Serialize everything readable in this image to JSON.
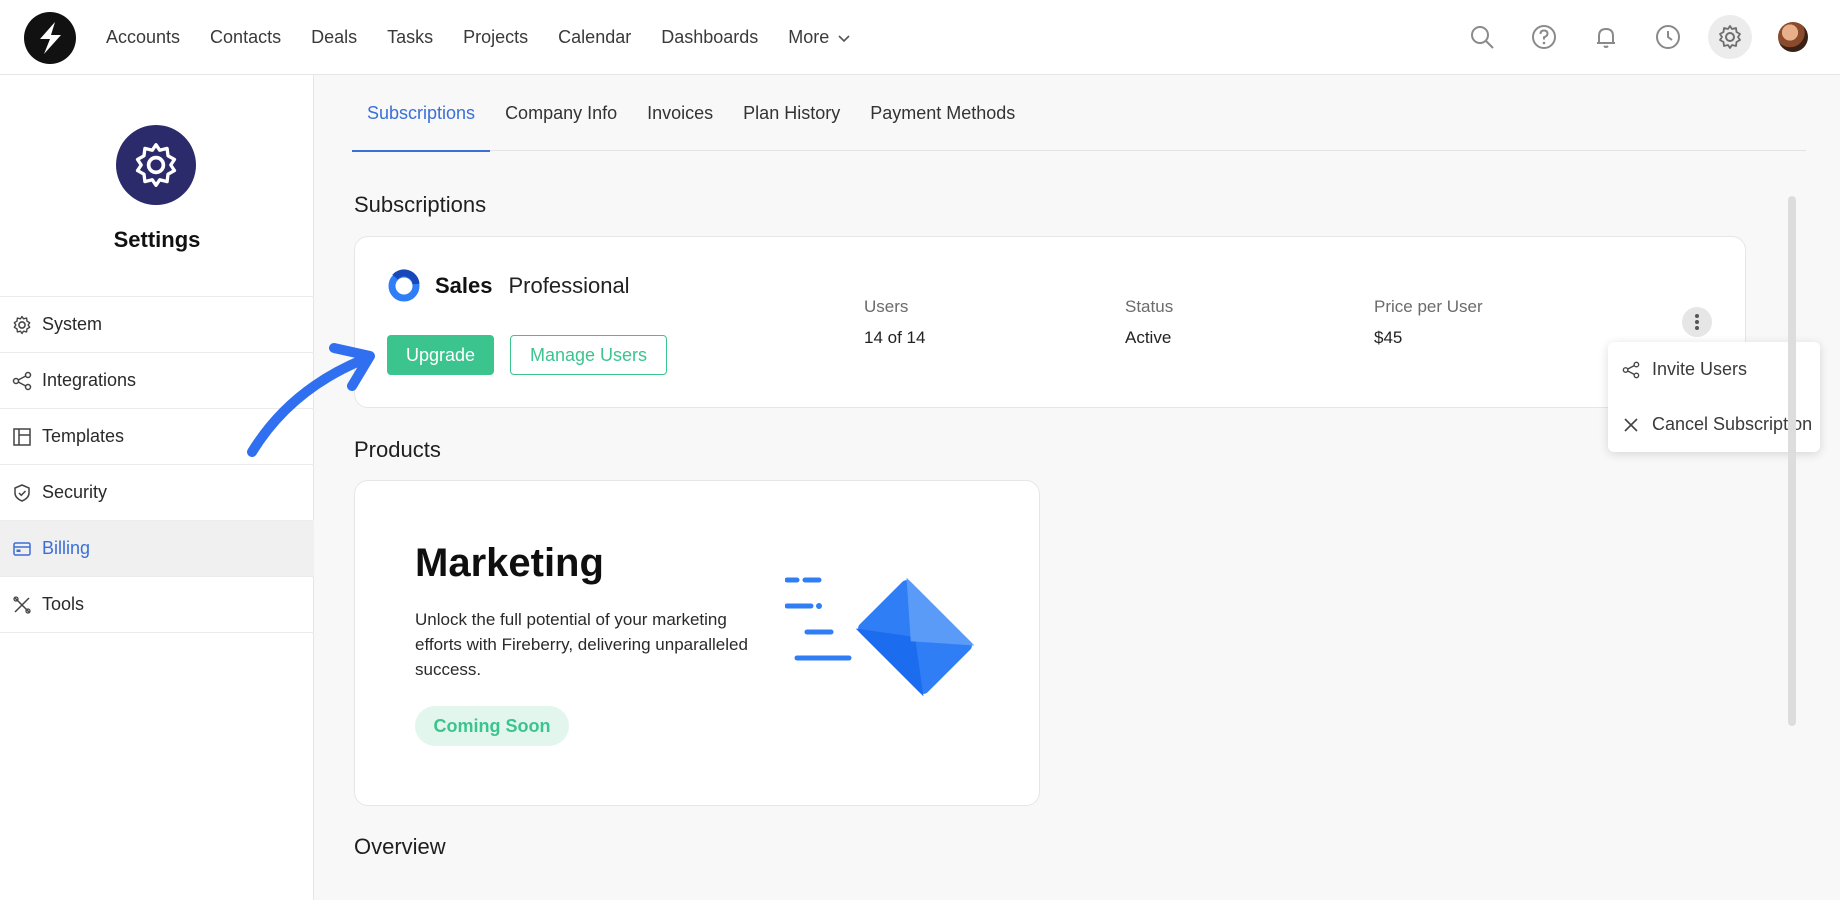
{
  "topbar": {
    "nav": [
      "Accounts",
      "Contacts",
      "Deals",
      "Tasks",
      "Projects",
      "Calendar",
      "Dashboards"
    ],
    "more_label": "More",
    "icons": [
      "search-icon",
      "help-icon",
      "bell-icon",
      "clock-icon",
      "gear-icon"
    ]
  },
  "sidebar": {
    "title": "Settings",
    "items": [
      {
        "label": "System",
        "icon": "gear-icon"
      },
      {
        "label": "Integrations",
        "icon": "share-icon"
      },
      {
        "label": "Templates",
        "icon": "layout-icon"
      },
      {
        "label": "Security",
        "icon": "shield-icon"
      },
      {
        "label": "Billing",
        "icon": "card-icon",
        "active": true
      },
      {
        "label": "Tools",
        "icon": "tools-icon"
      }
    ]
  },
  "tabs": [
    "Subscriptions",
    "Company Info",
    "Invoices",
    "Plan History",
    "Payment Methods"
  ],
  "active_tab": "Subscriptions",
  "subscriptions": {
    "heading": "Subscriptions",
    "plan_name": "Sales",
    "plan_tier": "Professional",
    "upgrade_label": "Upgrade",
    "manage_label": "Manage Users",
    "users_label": "Users",
    "users_value": "14 of 14",
    "status_label": "Status",
    "status_value": "Active",
    "price_label": "Price per User",
    "price_value": "$45"
  },
  "menu": {
    "invite": "Invite Users",
    "cancel": "Cancel Subscription"
  },
  "products": {
    "heading": "Products",
    "title": "Marketing",
    "description": "Unlock the full potential of your marketing efforts with Fireberry, delivering unparalleled success.",
    "badge": "Coming Soon"
  },
  "overview": {
    "heading": "Overview"
  },
  "colors": {
    "accent": "#3b6fd8",
    "green": "#3cc48f",
    "navy": "#2b2a6b",
    "blue": "#2f7ef5"
  }
}
